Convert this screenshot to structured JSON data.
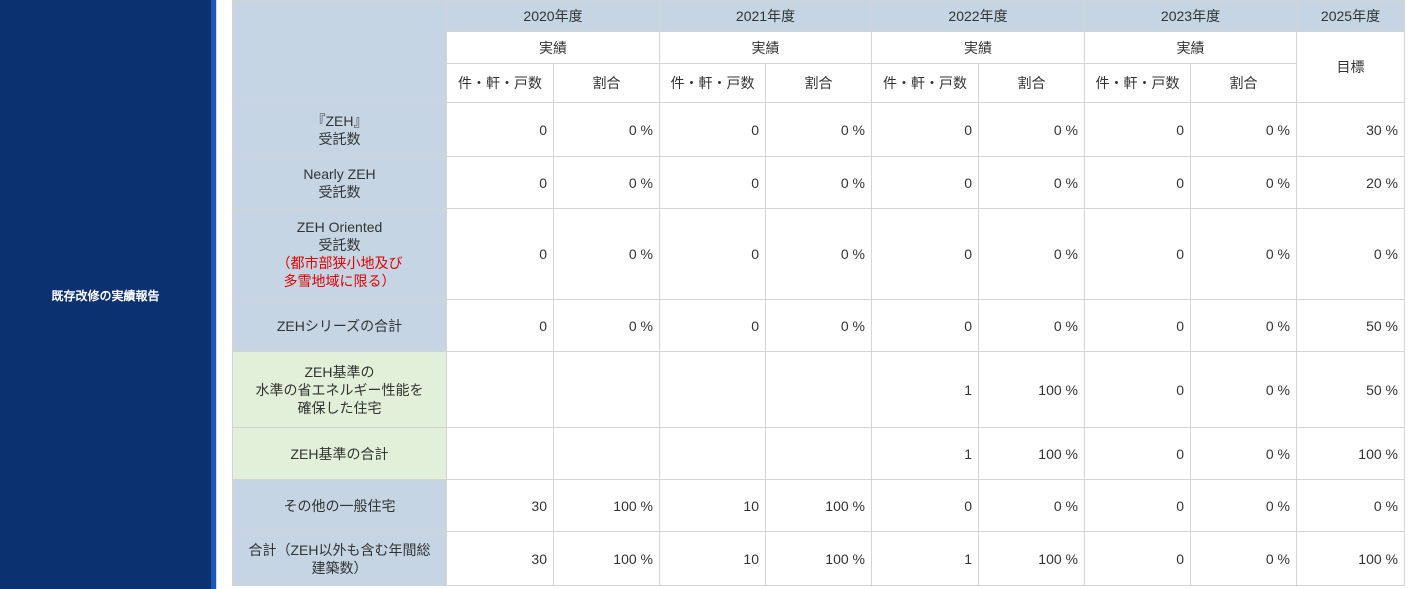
{
  "side_label": "既存改修の実績報告",
  "years": [
    "2020年度",
    "2021年度",
    "2022年度",
    "2023年度",
    "2025年度"
  ],
  "sub_actual": "実績",
  "sub_target": "目標",
  "col_count": "件・軒・戸数",
  "col_ratio": "割合",
  "rows": [
    {
      "label_lines": [
        "『ZEH』",
        "受託数"
      ],
      "red_lines": [],
      "green": false,
      "cells": [
        "0",
        "0 %",
        "0",
        "0 %",
        "0",
        "0 %",
        "0",
        "0 %",
        "30 %"
      ]
    },
    {
      "label_lines": [
        "Nearly ZEH",
        "受託数"
      ],
      "red_lines": [],
      "green": false,
      "cells": [
        "0",
        "0 %",
        "0",
        "0 %",
        "0",
        "0 %",
        "0",
        "0 %",
        "20 %"
      ]
    },
    {
      "label_lines": [
        "ZEH Oriented",
        "受託数"
      ],
      "red_lines": [
        "（都市部狭小地及び",
        "多雪地域に限る）"
      ],
      "green": false,
      "cells": [
        "0",
        "0 %",
        "0",
        "0 %",
        "0",
        "0 %",
        "0",
        "0 %",
        "0 %"
      ]
    },
    {
      "label_lines": [
        "ZEHシリーズの合計"
      ],
      "red_lines": [],
      "green": false,
      "cells": [
        "0",
        "0 %",
        "0",
        "0 %",
        "0",
        "0 %",
        "0",
        "0 %",
        "50 %"
      ]
    },
    {
      "label_lines": [
        "ZEH基準の",
        "水準の省エネルギー性能を",
        "確保した住宅"
      ],
      "red_lines": [],
      "green": true,
      "cells": [
        "",
        "",
        "",
        "",
        "1",
        "100 %",
        "0",
        "0 %",
        "50 %"
      ]
    },
    {
      "label_lines": [
        "ZEH基準の合計"
      ],
      "red_lines": [],
      "green": true,
      "cells": [
        "",
        "",
        "",
        "",
        "1",
        "100 %",
        "0",
        "0 %",
        "100 %"
      ]
    },
    {
      "label_lines": [
        "その他の一般住宅"
      ],
      "red_lines": [],
      "green": false,
      "cells": [
        "30",
        "100 %",
        "10",
        "100 %",
        "0",
        "0 %",
        "0",
        "0 %",
        "0 %"
      ]
    },
    {
      "label_lines": [
        "合計（ZEH以外も含む年間総",
        "建築数）"
      ],
      "red_lines": [],
      "green": false,
      "cells": [
        "30",
        "100 %",
        "10",
        "100 %",
        "1",
        "100 %",
        "0",
        "0 %",
        "100 %"
      ]
    }
  ]
}
